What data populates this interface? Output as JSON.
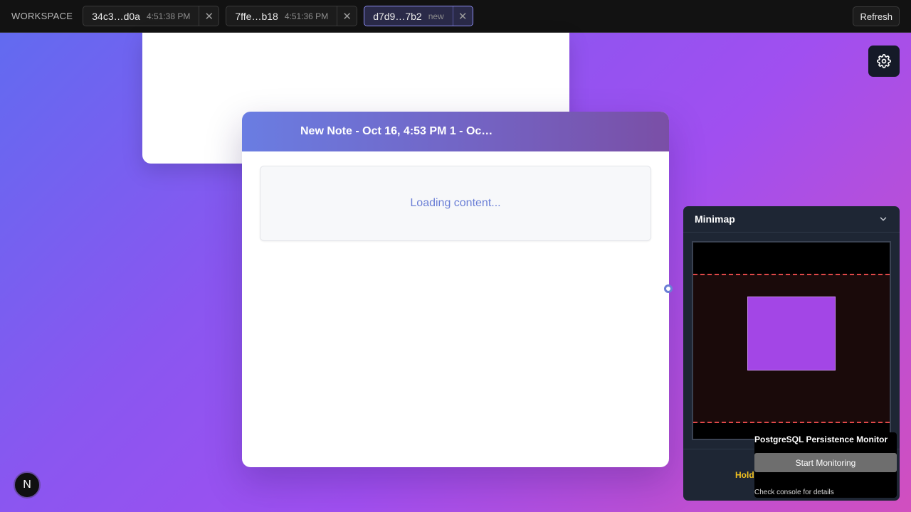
{
  "topbar": {
    "workspace_label": "WORKSPACE",
    "tabs": [
      {
        "id": "34c3…d0a",
        "time": "4:51:38 PM",
        "close": "✕"
      },
      {
        "id": "7ffe…b18",
        "time": "4:51:36 PM",
        "close": "✕"
      },
      {
        "id": "d7d9…7b2",
        "time": "new",
        "close": "✕",
        "active": true
      }
    ],
    "refresh_label": "Refresh"
  },
  "settings": {
    "icon": "gear-icon"
  },
  "note": {
    "title": "New Note - Oct 16, 4:53 PM 1 - Oc…",
    "loading_text": "Loading content..."
  },
  "minimap": {
    "title": "Minimap",
    "collapse_icon": "chevron-down-icon",
    "hint": "Hold"
  },
  "pg_monitor": {
    "title": "PostgreSQL Persistence Monitor",
    "button_label": "Start Monitoring",
    "note": "Check console for details"
  },
  "badge": {
    "letter": "N"
  },
  "colors": {
    "accent": "#6b7fd6",
    "minimap_node": "#a346e6",
    "viewport_border": "#e04848",
    "hint": "#f0c020"
  }
}
